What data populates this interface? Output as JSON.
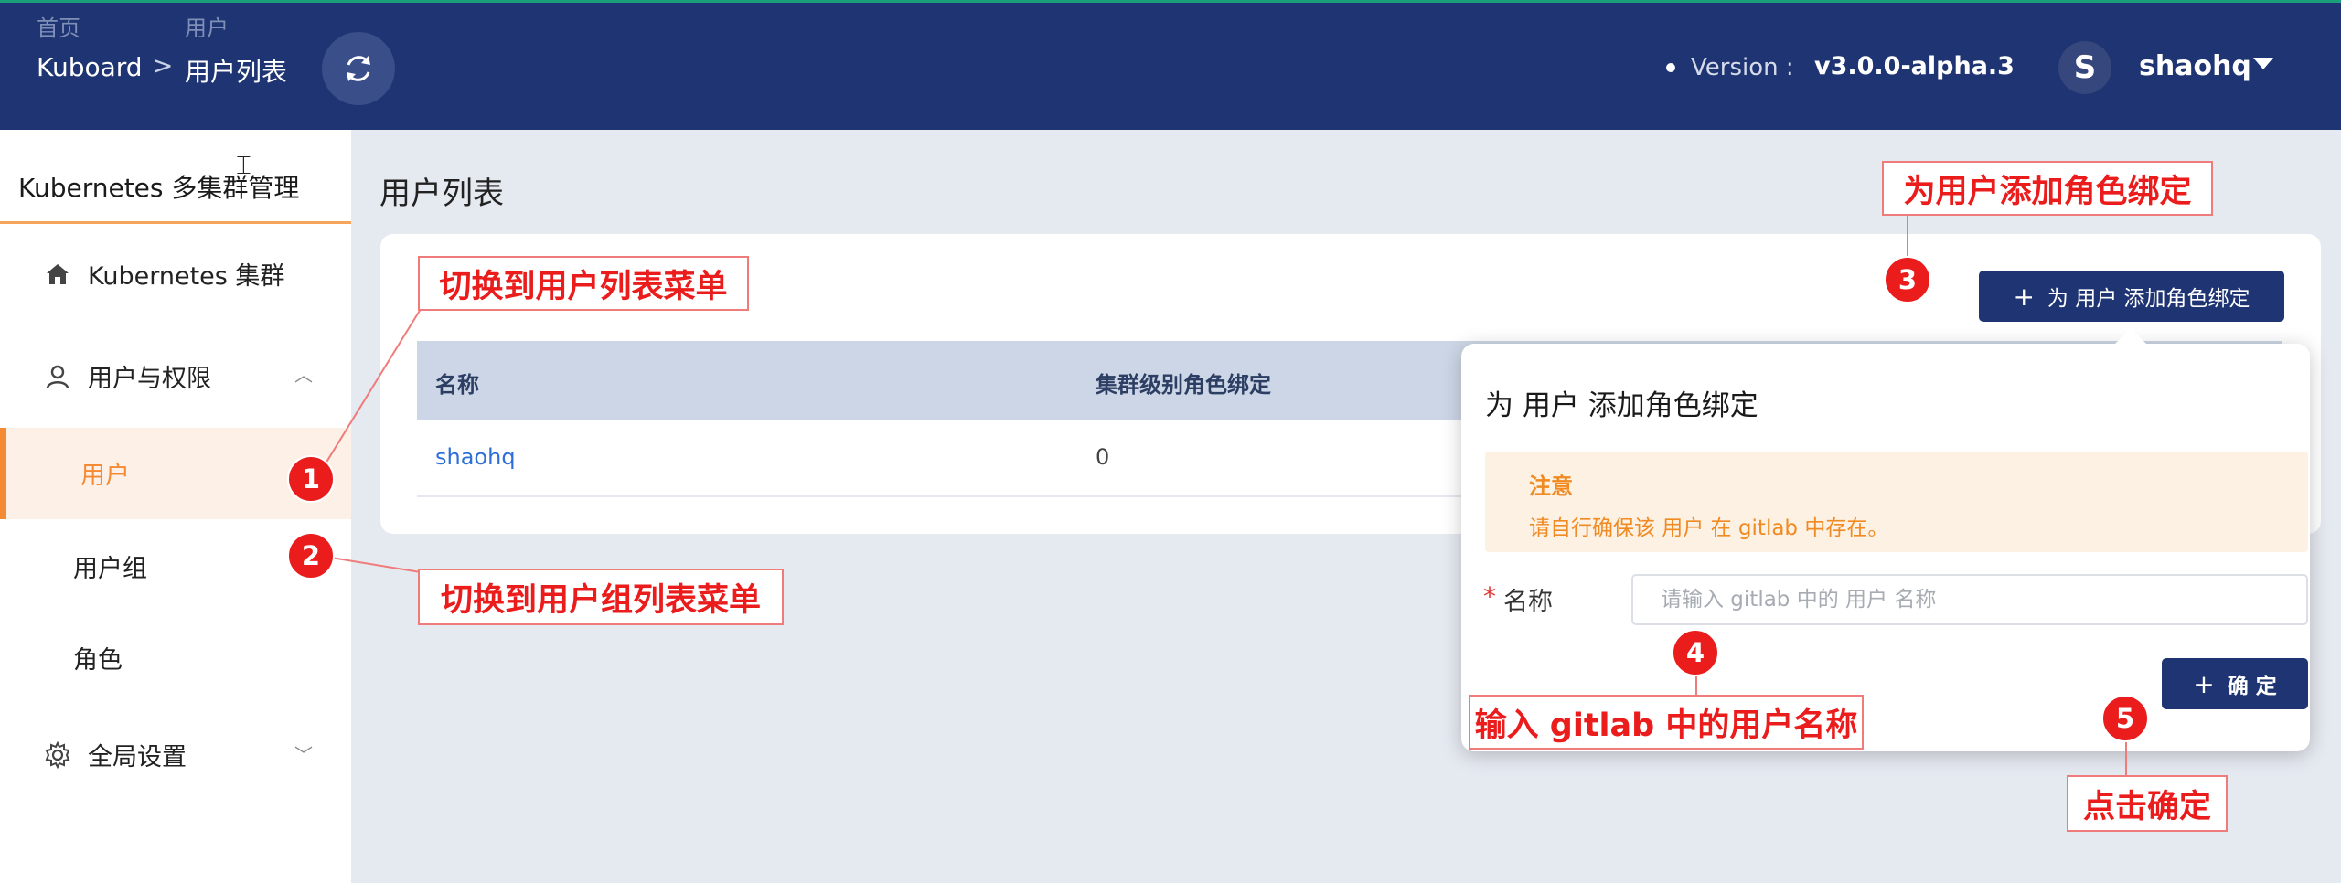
{
  "header": {
    "breadcrumb_top": [
      "首页",
      "用户"
    ],
    "breadcrumb": [
      "Kuboard",
      "用户列表"
    ],
    "separator": ">",
    "version_label": "Version :",
    "version_value": "v3.0.0-alpha.3",
    "avatar_letter": "S",
    "username": "shaohq"
  },
  "sidebar": {
    "title": "Kubernetes 多集群管理",
    "items": [
      {
        "label": "Kubernetes 集群",
        "icon": "home-icon"
      },
      {
        "label": "用户与权限",
        "icon": "user-icon"
      },
      {
        "label": "用户",
        "active": true
      },
      {
        "label": "用户组"
      },
      {
        "label": "角色"
      },
      {
        "label": "全局设置",
        "icon": "gear-icon"
      }
    ]
  },
  "main": {
    "title": "用户列表",
    "add_button": "为 用户 添加角色绑定",
    "table": {
      "columns": [
        "名称",
        "集群级别角色绑定"
      ],
      "rows": [
        {
          "name": "shaohq",
          "cluster_roles": "0"
        }
      ]
    }
  },
  "popover": {
    "title": "为 用户 添加角色绑定",
    "notice_title": "注意",
    "notice_text": "请自行确保该 用户 在 gitlab 中存在。",
    "field_label": "名称",
    "field_placeholder": "请输入 gitlab 中的 用户 名称",
    "field_value": "",
    "confirm_button": "确 定"
  },
  "annotations": [
    {
      "num": "1",
      "text": "切换到用户列表菜单"
    },
    {
      "num": "2",
      "text": "切换到用户组列表菜单"
    },
    {
      "num": "3",
      "text": "为用户添加角色绑定"
    },
    {
      "num": "4",
      "text": "输入 gitlab 中的用户名称"
    },
    {
      "num": "5",
      "text": "点击确定"
    }
  ],
  "colors": {
    "header_bg": "#1f3472",
    "accent_orange": "#f58a34",
    "annotation_red": "#ea1c1c",
    "link_blue": "#2f6fd8"
  }
}
